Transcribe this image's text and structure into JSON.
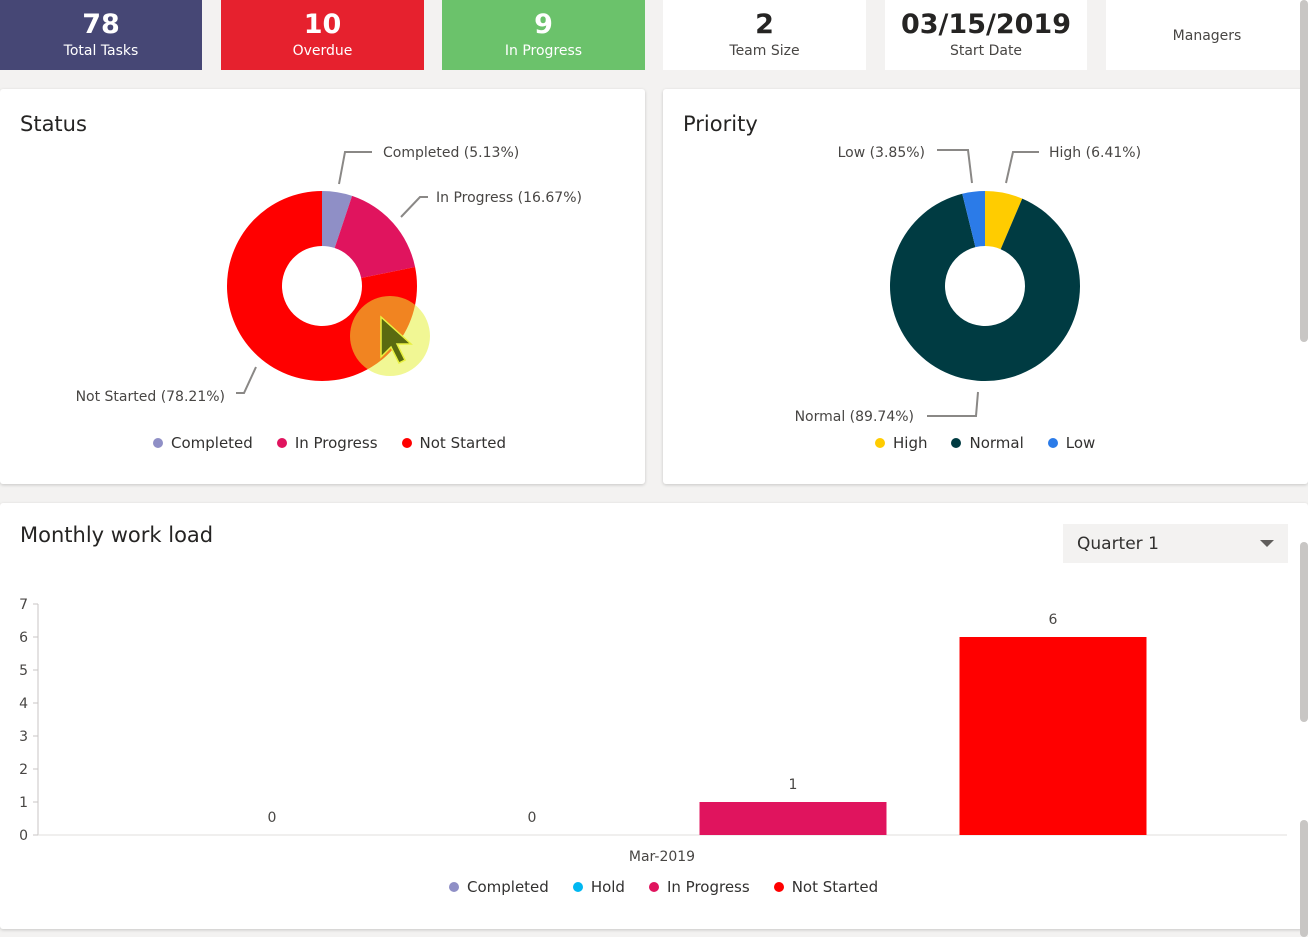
{
  "tiles": [
    {
      "value": "78",
      "label": "Total Tasks",
      "color": "#464775"
    },
    {
      "value": "10",
      "label": "Overdue",
      "color": "#e6212e"
    },
    {
      "value": "9",
      "label": "In Progress",
      "color": "#6bc26b"
    },
    {
      "value": "2",
      "label": "Team Size",
      "color": "#ffffff"
    },
    {
      "value": "03/15/2019",
      "label": "Start Date",
      "color": "#ffffff"
    },
    {
      "value": "",
      "label": "Managers",
      "color": "#ffffff"
    }
  ],
  "status": {
    "title": "Status",
    "legend": [
      "Completed",
      "In Progress",
      "Not Started"
    ]
  },
  "priority": {
    "title": "Priority",
    "legend": [
      "High",
      "Normal",
      "Low"
    ]
  },
  "workload": {
    "title": "Monthly work load",
    "quarter_selected": "Quarter 1",
    "legend": [
      "Completed",
      "Hold",
      "In Progress",
      "Not Started"
    ]
  },
  "chart_data": [
    {
      "type": "pie",
      "title": "Status",
      "categories": [
        "Completed",
        "In Progress",
        "Not Started"
      ],
      "values": [
        5.13,
        16.67,
        78.21
      ],
      "labels": [
        "Completed (5.13%)",
        "In Progress (16.67%)",
        "Not Started (78.21%)"
      ],
      "colors": [
        "#8f8fc6",
        "#e0145e",
        "#ff0000"
      ],
      "donut": true,
      "legend": "bottom"
    },
    {
      "type": "pie",
      "title": "Priority",
      "categories": [
        "High",
        "Normal",
        "Low"
      ],
      "values": [
        6.41,
        89.74,
        3.85
      ],
      "labels": [
        "High (6.41%)",
        "Normal (89.74%)",
        "Low (3.85%)"
      ],
      "colors": [
        "#ffcc00",
        "#003b42",
        "#2b7be8"
      ],
      "donut": true,
      "legend": "bottom"
    },
    {
      "type": "bar",
      "title": "Monthly work load",
      "categories": [
        "Mar-2019"
      ],
      "series": [
        {
          "name": "Completed",
          "values": [
            0
          ],
          "color": "#8f8fc6"
        },
        {
          "name": "Hold",
          "values": [
            0
          ],
          "color": "#00b7f1"
        },
        {
          "name": "In Progress",
          "values": [
            1
          ],
          "color": "#e0145e"
        },
        {
          "name": "Not Started",
          "values": [
            6
          ],
          "color": "#ff0000"
        }
      ],
      "yticks": [
        0,
        1,
        2,
        3,
        4,
        5,
        6,
        7
      ],
      "ylim": [
        0,
        7
      ],
      "data_labels": true,
      "legend": "bottom"
    }
  ]
}
